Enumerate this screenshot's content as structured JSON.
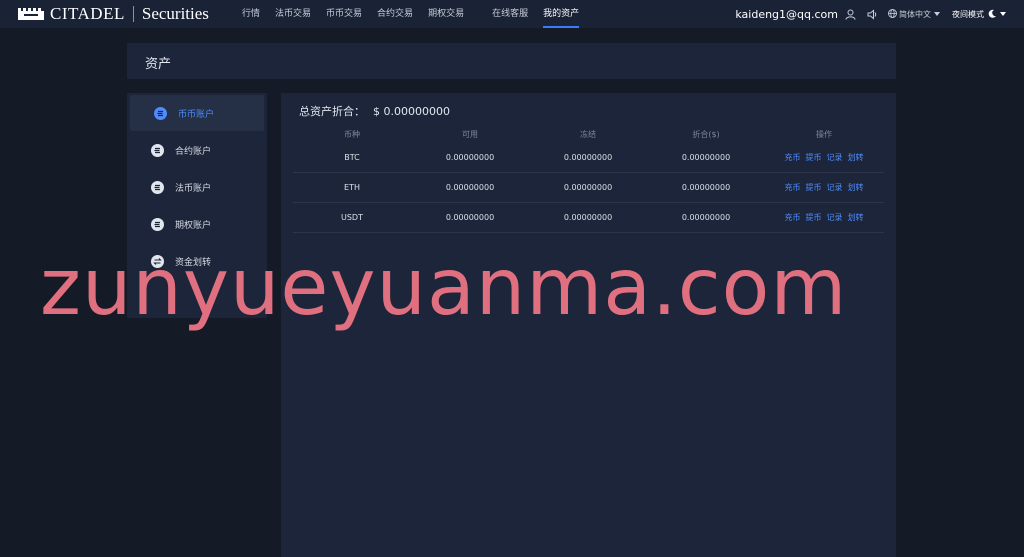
{
  "header": {
    "logo_text": "CITADEL",
    "logo_sub": "Securities",
    "nav": [
      {
        "label": "行情"
      },
      {
        "label": "法币交易"
      },
      {
        "label": "币币交易"
      },
      {
        "label": "合约交易"
      },
      {
        "label": "期权交易"
      },
      {
        "label": "在线客服"
      },
      {
        "label": "我的资产"
      }
    ],
    "email": "kaideng1@qq.com",
    "language": "简体中文",
    "night_mode": "夜间模式"
  },
  "page": {
    "title": "资产"
  },
  "sidebar": {
    "items": [
      {
        "label": "币币账户",
        "icon": "exchange-coin-icon"
      },
      {
        "label": "合约账户",
        "icon": "contract-coin-icon"
      },
      {
        "label": "法币账户",
        "icon": "fiat-coin-icon"
      },
      {
        "label": "期权账户",
        "icon": "option-coin-icon"
      },
      {
        "label": "资金划转",
        "icon": "transfer-icon"
      }
    ]
  },
  "assets": {
    "total_label": "总资产折合：",
    "total_value": "$ 0.00000000",
    "headers": [
      "币种",
      "可用",
      "冻结",
      "折合($)",
      "操作"
    ],
    "rows": [
      {
        "coin": "BTC",
        "available": "0.00000000",
        "frozen": "0.00000000",
        "converted": "0.00000000"
      },
      {
        "coin": "ETH",
        "available": "0.00000000",
        "frozen": "0.00000000",
        "converted": "0.00000000"
      },
      {
        "coin": "USDT",
        "available": "0.00000000",
        "frozen": "0.00000000",
        "converted": "0.00000000"
      }
    ],
    "ops": [
      "充币",
      "提币",
      "记录",
      "划转"
    ]
  },
  "watermark": "zunyueyuanma.com",
  "colors": {
    "accent": "#3d7bf5",
    "link": "#4d8cff",
    "panel": "#1c2539",
    "background": "#141a26",
    "watermark": "#e07080"
  }
}
